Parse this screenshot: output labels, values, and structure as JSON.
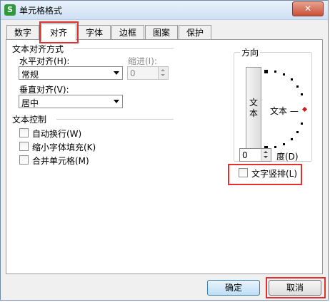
{
  "window": {
    "title": "单元格格式",
    "app_icon_letter": "S",
    "close_label": "✕"
  },
  "tabs": [
    {
      "label": "数字"
    },
    {
      "label": "对齐"
    },
    {
      "label": "字体"
    },
    {
      "label": "边框"
    },
    {
      "label": "图案"
    },
    {
      "label": "保护"
    }
  ],
  "active_tab": "对齐",
  "alignment": {
    "section_title": "文本对齐方式",
    "horizontal_label": "水平对齐(H):",
    "horizontal_value": "常规",
    "indent_label": "缩进(I):",
    "indent_value": "0",
    "vertical_label": "垂直对齐(V):",
    "vertical_value": "居中"
  },
  "text_control": {
    "section_title": "文本控制",
    "options": [
      {
        "label": "自动换行(W)",
        "checked": false
      },
      {
        "label": "缩小字体填充(K)",
        "checked": false
      },
      {
        "label": "合并单元格(M)",
        "checked": false
      }
    ]
  },
  "orientation": {
    "section_title": "方向",
    "vertical_text": "文\n本",
    "dial_text": "文本 —",
    "degree_value": "0",
    "degree_label": "度(D)",
    "vertical_layout_label": "文字竖排(L)",
    "vertical_layout_checked": false
  },
  "buttons": {
    "ok": "确定",
    "cancel": "取消"
  },
  "colors": {
    "highlight": "#e03030",
    "title_bar": "#cfe0f4",
    "dial_marker": "#c81e1e"
  }
}
